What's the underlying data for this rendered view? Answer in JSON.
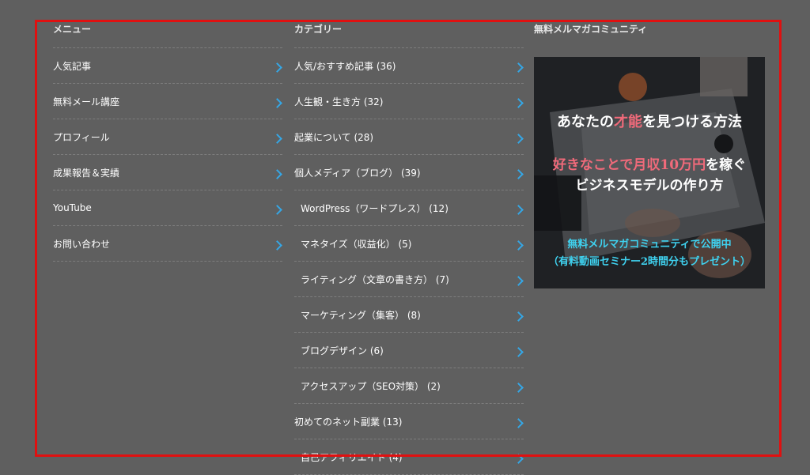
{
  "menu": {
    "title": "メニュー",
    "items": [
      {
        "label": "人気記事"
      },
      {
        "label": "無料メール講座"
      },
      {
        "label": "プロフィール"
      },
      {
        "label": "成果報告＆実績"
      },
      {
        "label": "YouTube"
      },
      {
        "label": "お問い合わせ"
      }
    ]
  },
  "categories": {
    "title": "カテゴリー",
    "items": [
      {
        "label": "人気/おすすめ記事 (36)",
        "child": false
      },
      {
        "label": "人生観・生き方 (32)",
        "child": false
      },
      {
        "label": "起業について (28)",
        "child": false
      },
      {
        "label": "個人メディア（ブログ） (39)",
        "child": false
      },
      {
        "label": "WordPress（ワードプレス） (12)",
        "child": true
      },
      {
        "label": "マネタイズ（収益化） (5)",
        "child": true
      },
      {
        "label": "ライティング（文章の書き方） (7)",
        "child": true
      },
      {
        "label": "マーケティング（集客） (8)",
        "child": true
      },
      {
        "label": "ブログデザイン (6)",
        "child": true
      },
      {
        "label": "アクセスアップ（SEO対策） (2)",
        "child": true
      },
      {
        "label": "初めてのネット副業 (13)",
        "child": false
      },
      {
        "label": "自己アフィリエイト (4)",
        "child": true
      }
    ]
  },
  "magazine": {
    "title": "無料メルマガコミュニティ",
    "banner": {
      "line1_pre": "あなたの",
      "line1_hl": "才能",
      "line1_post": "を見つける方法",
      "line2_hl": "好きなことで月収10万円",
      "line2_post": "を稼ぐ",
      "line3": "ビジネスモデルの作り方",
      "line4": "無料メルマガコミュニティで公開中",
      "line5": "（有料動画セミナー2時間分もプレゼント）"
    }
  },
  "colors": {
    "background": "#5f5f5f",
    "chevron": "#35a7e6",
    "frame": "#e01010",
    "banner_highlight": "#f06a7a",
    "banner_cyan": "#3fd2f0"
  }
}
